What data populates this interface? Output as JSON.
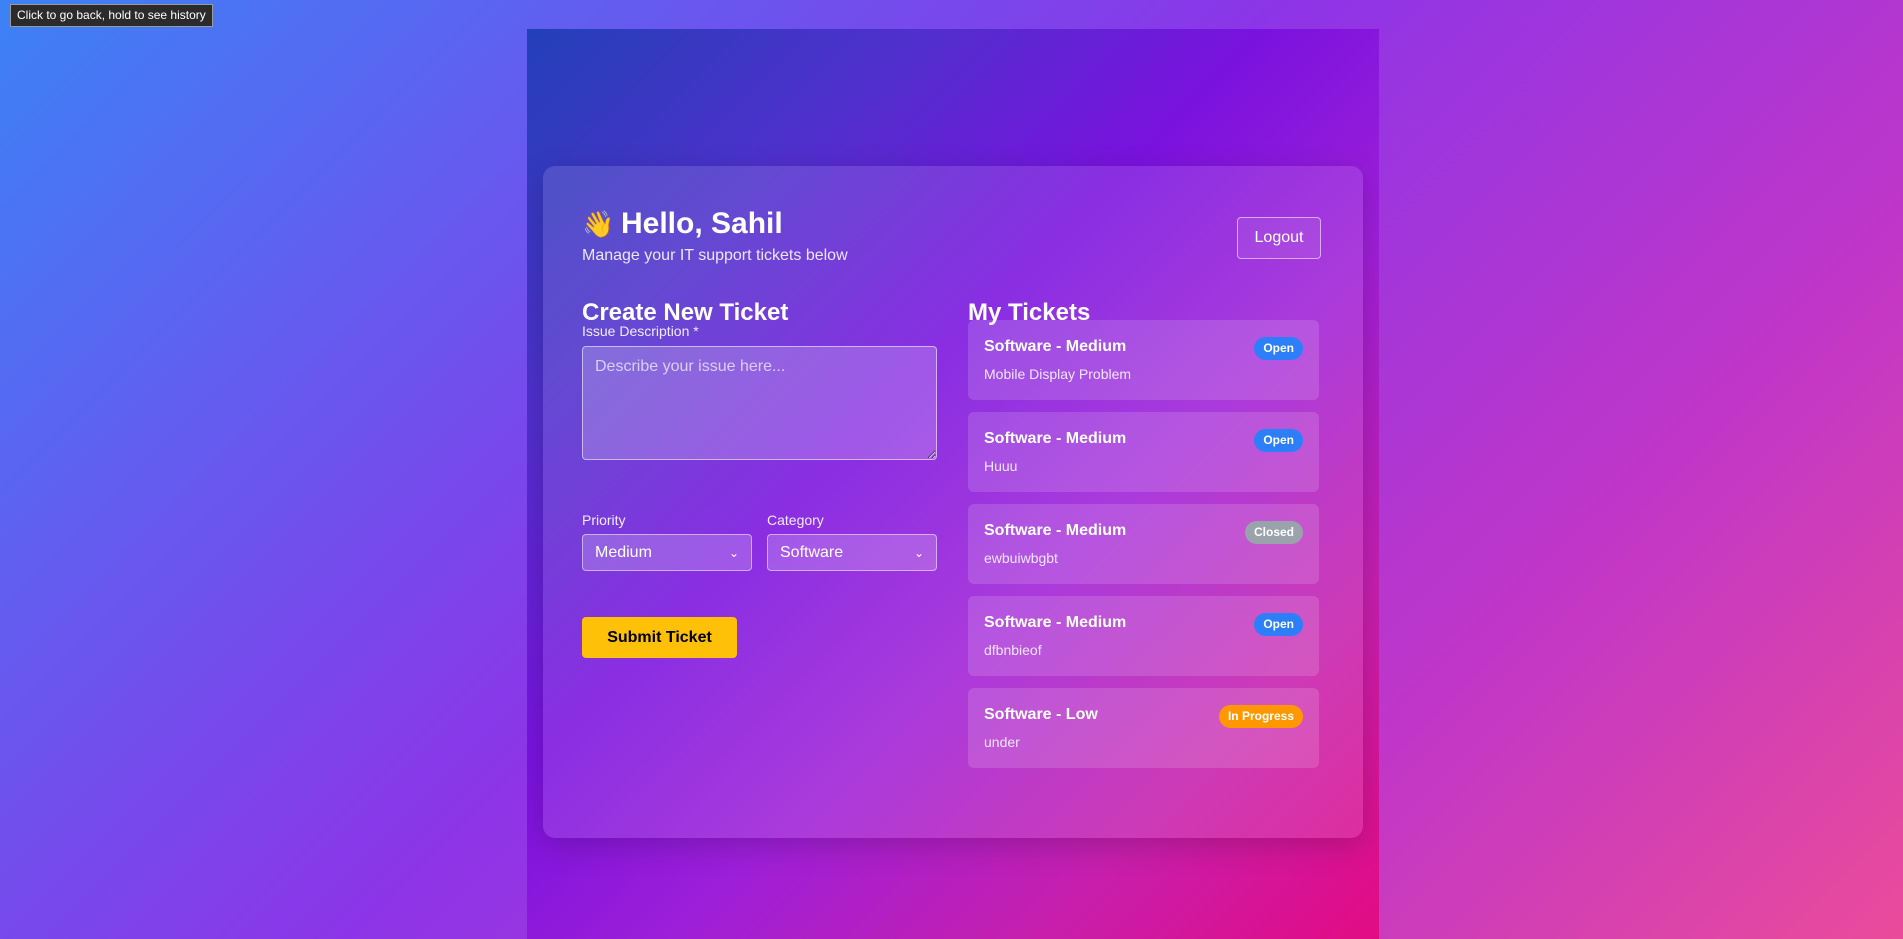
{
  "browser": {
    "back_tooltip": "Click to go back, hold to see history"
  },
  "header": {
    "wave_icon": "👋",
    "greeting": "Hello, Sahil",
    "subtitle": "Manage your IT support tickets below",
    "logout_label": "Logout"
  },
  "create_ticket": {
    "title": "Create New Ticket",
    "description_label": "Issue Description *",
    "description_placeholder": "Describe your issue here...",
    "description_value": "",
    "priority_label": "Priority",
    "priority_value": "Medium",
    "category_label": "Category",
    "category_value": "Software",
    "submit_label": "Submit Ticket"
  },
  "my_tickets": {
    "title": "My Tickets",
    "items": [
      {
        "title": "Software - Medium",
        "description": "Mobile Display Problem",
        "status": "Open",
        "status_color": "#2d7ff9"
      },
      {
        "title": "Software - Medium",
        "description": "Huuu",
        "status": "Open",
        "status_color": "#2d7ff9"
      },
      {
        "title": "Software - Medium",
        "description": "ewbuiwbgbt",
        "status": "Closed",
        "status_color": "#9aa2ac"
      },
      {
        "title": "Software - Medium",
        "description": "dfbnbieof",
        "status": "Open",
        "status_color": "#2d7ff9"
      },
      {
        "title": "Software - Low",
        "description": "under",
        "status": "In Progress",
        "status_color": "#ff9800"
      }
    ]
  },
  "colors": {
    "accent": "#ffc107",
    "open_badge": "#2d7ff9",
    "closed_badge": "#9aa2ac",
    "progress_badge": "#ff9800"
  }
}
